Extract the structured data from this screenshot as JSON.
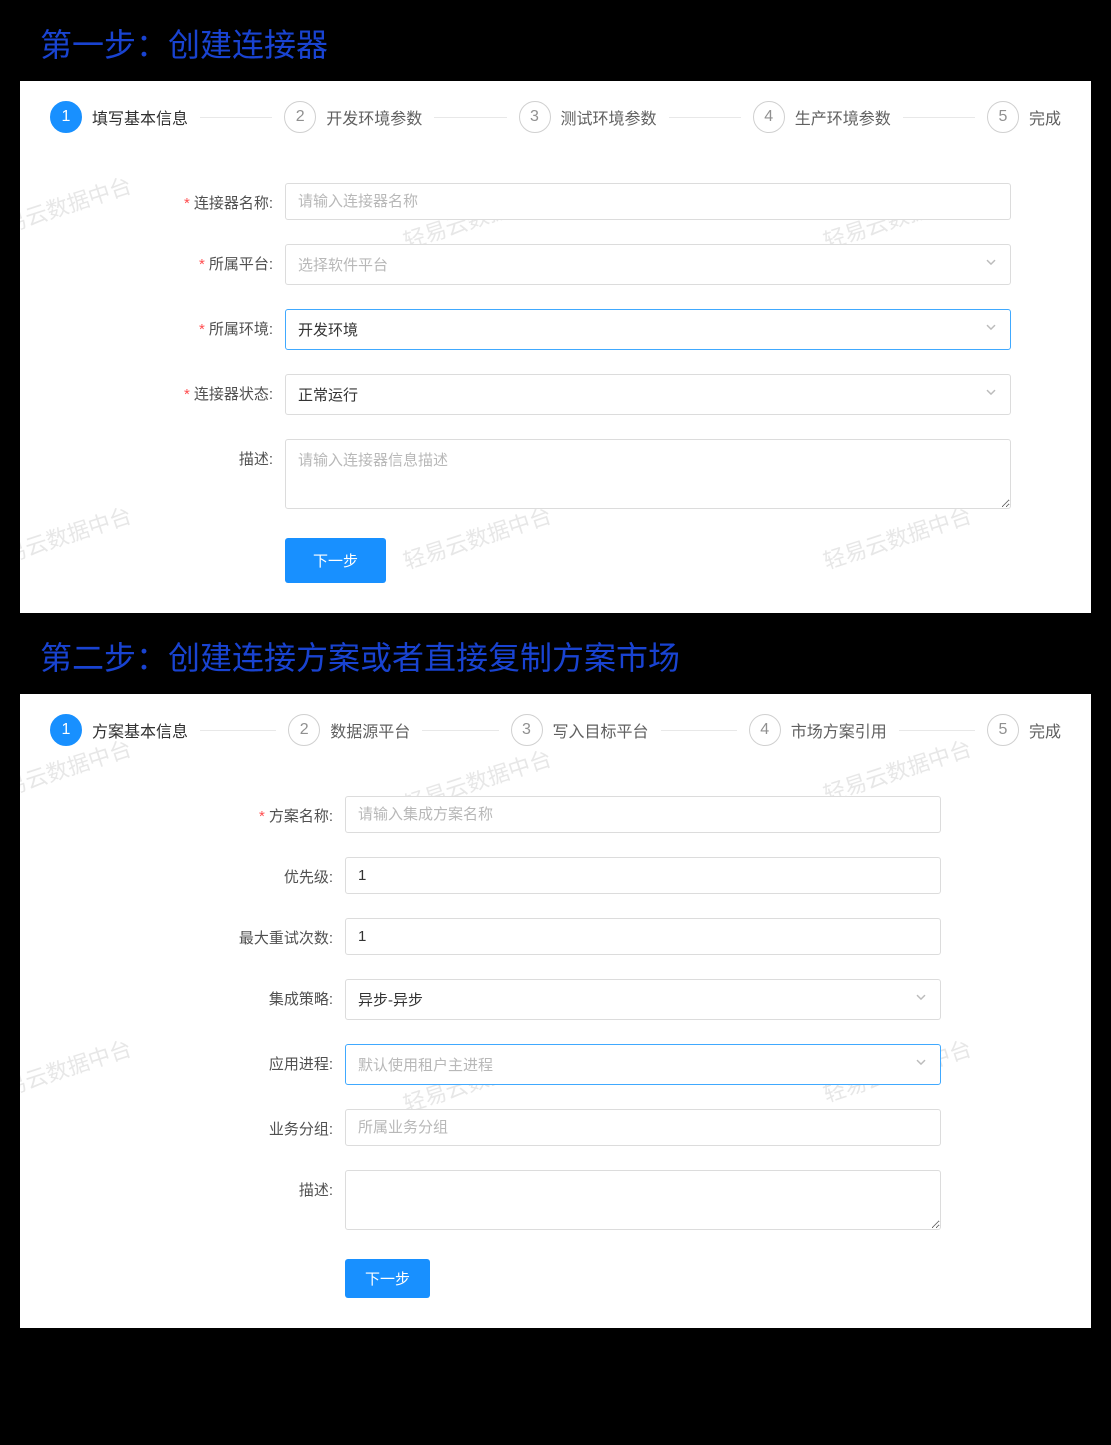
{
  "watermark": "轻易云数据中台",
  "section1": {
    "title": "第一步：创建连接器",
    "steps": [
      {
        "num": "1",
        "label": "填写基本信息"
      },
      {
        "num": "2",
        "label": "开发环境参数"
      },
      {
        "num": "3",
        "label": "测试环境参数"
      },
      {
        "num": "4",
        "label": "生产环境参数"
      },
      {
        "num": "5",
        "label": "完成"
      }
    ],
    "form": {
      "connector_name_label": "连接器名称:",
      "connector_name_placeholder": "请输入连接器名称",
      "platform_label": "所属平台:",
      "platform_placeholder": "选择软件平台",
      "env_label": "所属环境:",
      "env_value": "开发环境",
      "status_label": "连接器状态:",
      "status_value": "正常运行",
      "desc_label": "描述:",
      "desc_placeholder": "请输入连接器信息描述",
      "next_button": "下一步"
    }
  },
  "section2": {
    "title": "第二步：创建连接方案或者直接复制方案市场",
    "steps": [
      {
        "num": "1",
        "label": "方案基本信息"
      },
      {
        "num": "2",
        "label": "数据源平台"
      },
      {
        "num": "3",
        "label": "写入目标平台"
      },
      {
        "num": "4",
        "label": "市场方案引用"
      },
      {
        "num": "5",
        "label": "完成"
      }
    ],
    "form": {
      "plan_name_label": "方案名称:",
      "plan_name_placeholder": "请输入集成方案名称",
      "priority_label": "优先级:",
      "priority_value": "1",
      "retry_label": "最大重试次数:",
      "retry_value": "1",
      "strategy_label": "集成策略:",
      "strategy_value": "异步-异步",
      "process_label": "应用进程:",
      "process_placeholder": "默认使用租户主进程",
      "group_label": "业务分组:",
      "group_placeholder": "所属业务分组",
      "desc_label": "描述:",
      "next_button": "下一步"
    }
  }
}
